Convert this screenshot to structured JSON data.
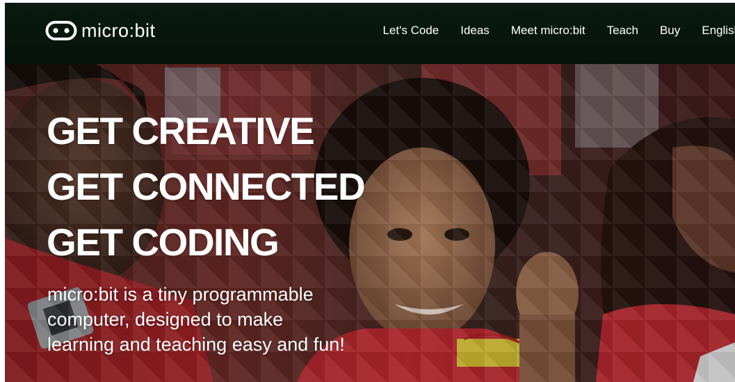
{
  "brand": {
    "logo_text": "micro:bit",
    "logo_icon": "microbit-logo-icon"
  },
  "nav": {
    "items": [
      {
        "label": "Let's Code"
      },
      {
        "label": "Ideas"
      },
      {
        "label": "Meet micro:bit"
      },
      {
        "label": "Teach"
      },
      {
        "label": "Buy"
      },
      {
        "label": "English"
      }
    ]
  },
  "hero": {
    "headline_lines": [
      "GET CREATIVE",
      "GET CONNECTED",
      "GET CODING"
    ],
    "tagline_lines": [
      "micro:bit is a tiny programmable",
      "computer, designed to make",
      "learning and teaching easy and fun!"
    ],
    "image": "students-wearing-microbit-photo"
  },
  "colors": {
    "navbar_bg": "#06130c",
    "text": "#ffffff",
    "accent_red": "#c8232c"
  }
}
